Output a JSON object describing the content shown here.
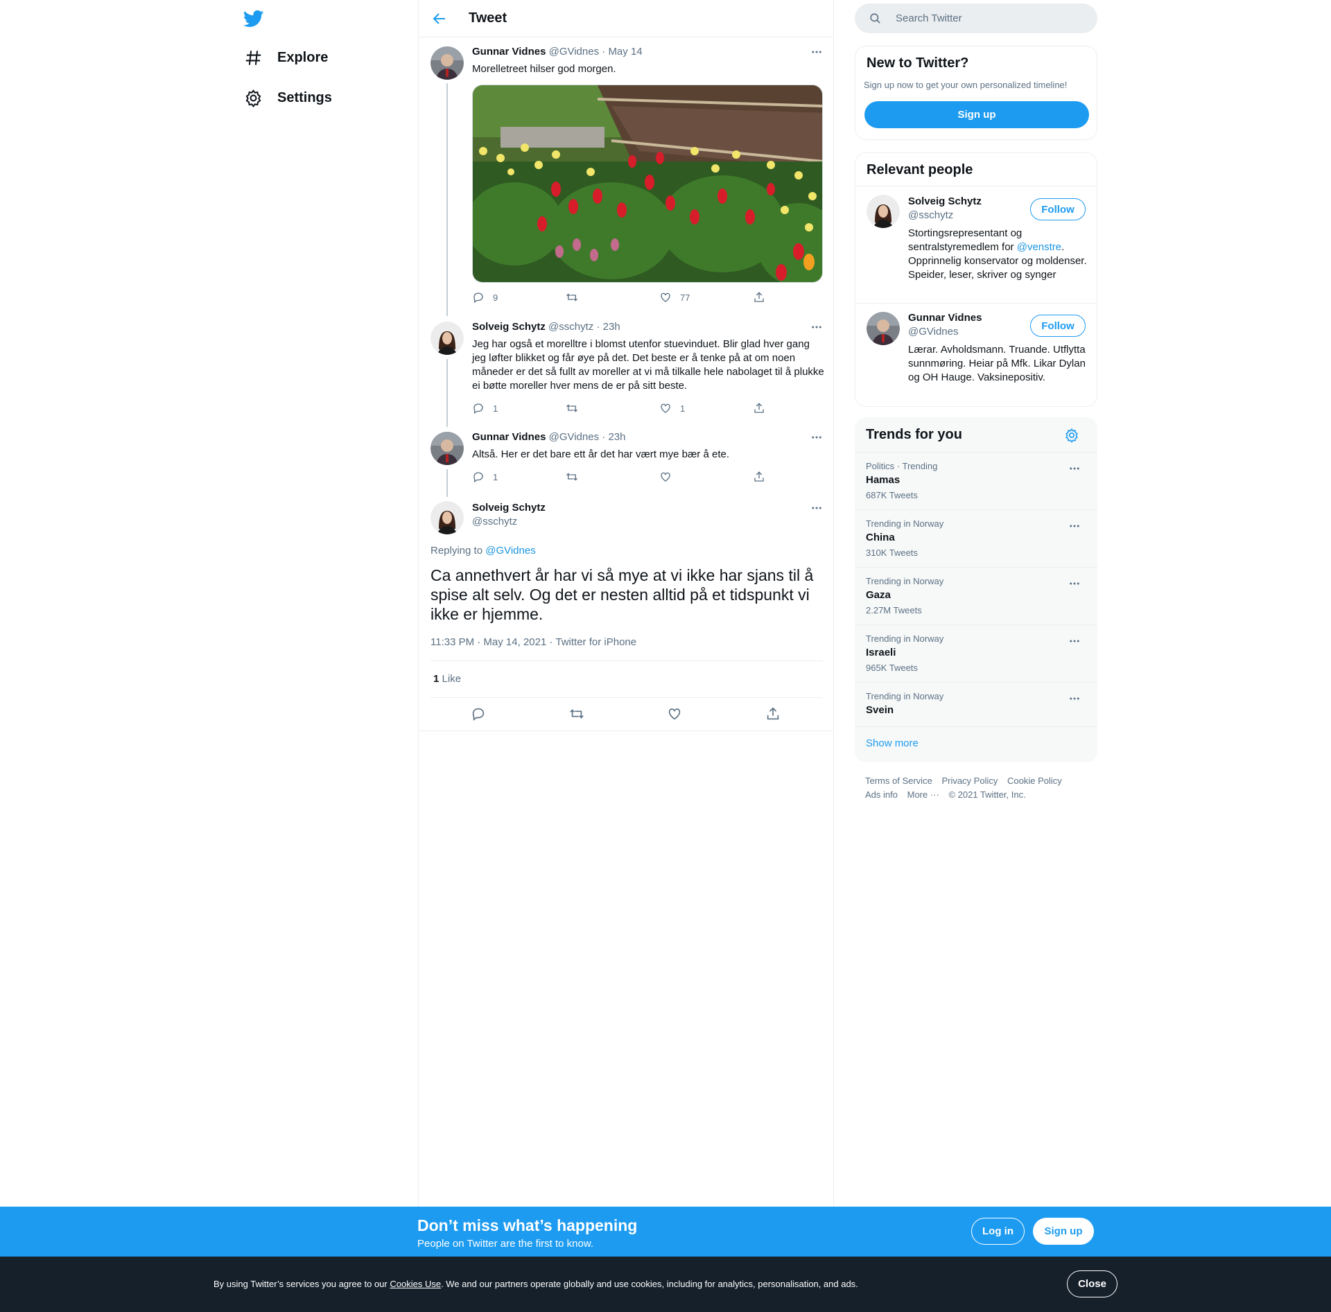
{
  "nav": {
    "items": [
      {
        "label": "Explore",
        "icon": "hashtag-icon"
      },
      {
        "label": "Settings",
        "icon": "gear-icon"
      }
    ]
  },
  "header": {
    "title": "Tweet"
  },
  "thread": [
    {
      "name": "Gunnar Vidnes",
      "handle": "@GVidnes",
      "time": "May 14",
      "text": "Morelletreet hilser god morgen.",
      "replies": "9",
      "retweets": "",
      "likes": "77"
    },
    {
      "name": "Solveig Schytz",
      "handle": "@sschytz",
      "time": "23h",
      "text": "Jeg har også et morelltre i blomst utenfor stuevinduet. Blir glad hver gang jeg løfter blikket og får øye på det. Det beste er å tenke på at om noen måneder er det så fullt av moreller at vi må tilkalle hele nabolaget til å plukke ei bøtte moreller hver mens de er på sitt beste.",
      "replies": "1",
      "retweets": "",
      "likes": "1"
    },
    {
      "name": "Gunnar Vidnes",
      "handle": "@GVidnes",
      "time": "23h",
      "text": "Altså. Her er det bare ett år det har vært mye bær å ete.",
      "replies": "1",
      "retweets": "",
      "likes": ""
    }
  ],
  "main_tweet": {
    "name": "Solveig Schytz",
    "handle": "@sschytz",
    "replying_prefix": "Replying to",
    "replying_to": "@GVidnes",
    "text": "Ca annethvert år har vi så mye at vi ikke har sjans til å spise alt selv. Og det er nesten alltid på et tidspunkt vi ikke er hjemme.",
    "timestamp": "11:33 PM · May 14, 2021 · Twitter for iPhone",
    "like_count": "1",
    "like_label": "Like"
  },
  "search": {
    "placeholder": "Search Twitter"
  },
  "signup_card": {
    "title": "New to Twitter?",
    "subtitle": "Sign up now to get your own personalized timeline!",
    "button": "Sign up"
  },
  "relevant": {
    "title": "Relevant people",
    "follow_label": "Follow",
    "people": [
      {
        "name": "Solveig Schytz",
        "handle": "@sschytz",
        "bio_1": "Stortingsrepresentant og sentralstyremedlem for ",
        "bio_link": "@venstre",
        "bio_2": ". Opprinnelig konservator og moldenser. Speider, leser, skriver og synger"
      },
      {
        "name": "Gunnar Vidnes",
        "handle": "@GVidnes",
        "bio": "Lærar. Avholdsmann. Truande. Utflytta sunnmøring. Heiar på Mfk. Likar Dylan og OH Hauge. Vaksinepositiv."
      }
    ]
  },
  "trends": {
    "title": "Trends for you",
    "items": [
      {
        "meta": "Politics · Trending",
        "name": "Hamas",
        "count": "687K Tweets"
      },
      {
        "meta": "Trending in Norway",
        "name": "China",
        "count": "310K Tweets"
      },
      {
        "meta": "Trending in Norway",
        "name": "Gaza",
        "count": "2.27M Tweets"
      },
      {
        "meta": "Trending in Norway",
        "name": "Israeli",
        "count": "965K Tweets"
      },
      {
        "meta": "Trending in Norway",
        "name": "Svein",
        "count": ""
      }
    ],
    "show_more": "Show more"
  },
  "footer": {
    "links": [
      "Terms of Service",
      "Privacy Policy",
      "Cookie Policy",
      "Ads info",
      "More ···"
    ],
    "copyright": "© 2021 Twitter, Inc."
  },
  "banner": {
    "heading": "Don’t miss what’s happening",
    "sub": "People on Twitter are the first to know.",
    "login": "Log in",
    "signup": "Sign up"
  },
  "cookie": {
    "text_1": "By using Twitter’s services you agree to our ",
    "link": "Cookies Use",
    "text_2": ". We and our partners operate globally and use cookies, including for analytics, personalisation, and ads.",
    "close": "Close"
  },
  "colors": {
    "accent": "#1d9bf0",
    "cookie_bg": "#15202b",
    "muted": "#5b7083"
  }
}
